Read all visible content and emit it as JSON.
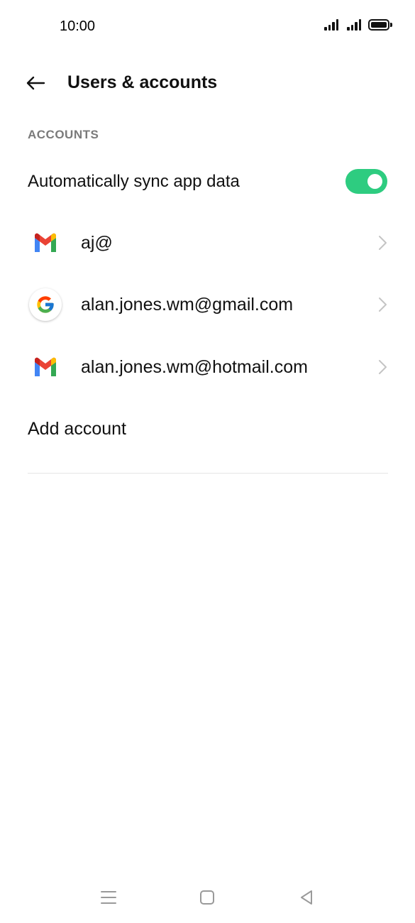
{
  "status_bar": {
    "time": "10:00"
  },
  "header": {
    "title": "Users & accounts"
  },
  "accounts_section": {
    "label": "ACCOUNTS",
    "sync": {
      "label": "Automatically sync app data",
      "enabled": true
    },
    "items": [
      {
        "icon": "gmail-icon",
        "label": "aj@"
      },
      {
        "icon": "google-icon",
        "label": "alan.jones.wm@gmail.com"
      },
      {
        "icon": "gmail-icon",
        "label": "alan.jones.wm@hotmail.com"
      }
    ],
    "add_account_label": "Add account"
  },
  "colors": {
    "toggle_on": "#2ecc80",
    "section_label": "#7a7a7a"
  }
}
